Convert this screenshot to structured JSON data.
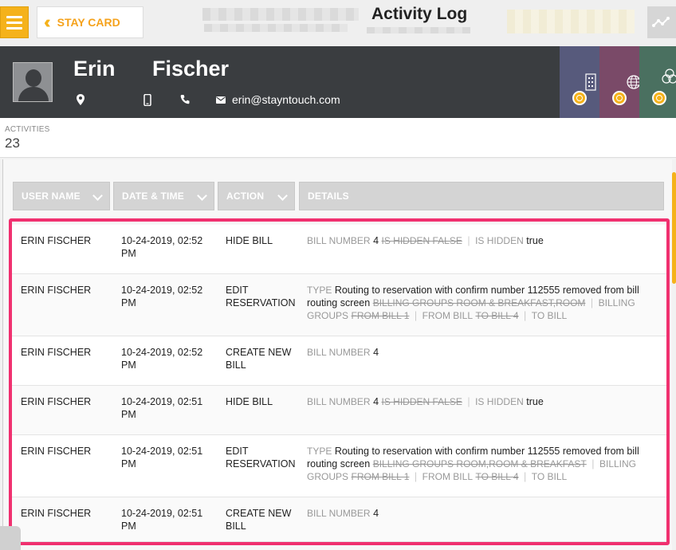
{
  "header": {
    "title": "Activity Log",
    "back_label": "STAY CARD"
  },
  "guest": {
    "first_name": "Erin",
    "last_name": "Fischer",
    "email": "erin@stayntouch.com",
    "tiles": [
      {
        "icon": "building-icon",
        "color": "#575a7c"
      },
      {
        "icon": "globe-icon",
        "color": "#7a4a68"
      },
      {
        "icon": "circles-icon",
        "color": "#4a7060"
      }
    ]
  },
  "activities": {
    "label": "ACTIVITIES",
    "count": "23"
  },
  "columns": [
    "USER NAME",
    "DATE & TIME",
    "ACTION",
    "DETAILS"
  ],
  "rows": [
    {
      "user": "ERIN FISCHER",
      "date": "10-24-2019, 02:52 PM",
      "action": "HIDE BILL",
      "details": [
        {
          "t": "k",
          "v": "BILL NUMBER"
        },
        {
          "t": "v",
          "v": "4"
        },
        {
          "t": "s",
          "v": "IS HIDDEN FALSE"
        },
        {
          "t": "sep",
          "v": "|"
        },
        {
          "t": "k",
          "v": "IS HIDDEN"
        },
        {
          "t": "v",
          "v": "true"
        }
      ]
    },
    {
      "user": "ERIN FISCHER",
      "date": "10-24-2019, 02:52 PM",
      "action": "EDIT RESERVATION",
      "details": [
        {
          "t": "k",
          "v": "TYPE"
        },
        {
          "t": "v",
          "v": "Routing to reservation with confirm number 112555 removed from bill routing screen"
        },
        {
          "t": "s",
          "v": "BILLING GROUPS ROOM & BREAKFAST,ROOM"
        },
        {
          "t": "sep",
          "v": "|"
        },
        {
          "t": "k",
          "v": "BILLING GROUPS"
        },
        {
          "t": "s",
          "v": "FROM BILL 1"
        },
        {
          "t": "sep",
          "v": "|"
        },
        {
          "t": "k",
          "v": "FROM BILL"
        },
        {
          "t": "s",
          "v": "TO BILL 4"
        },
        {
          "t": "sep",
          "v": "|"
        },
        {
          "t": "k",
          "v": "TO BILL"
        }
      ]
    },
    {
      "user": "ERIN FISCHER",
      "date": "10-24-2019, 02:52 PM",
      "action": "CREATE NEW BILL",
      "details": [
        {
          "t": "k",
          "v": "BILL NUMBER"
        },
        {
          "t": "v",
          "v": "4"
        }
      ]
    },
    {
      "user": "ERIN FISCHER",
      "date": "10-24-2019, 02:51 PM",
      "action": "HIDE BILL",
      "details": [
        {
          "t": "k",
          "v": "BILL NUMBER"
        },
        {
          "t": "v",
          "v": "4"
        },
        {
          "t": "s",
          "v": "IS HIDDEN FALSE"
        },
        {
          "t": "sep",
          "v": "|"
        },
        {
          "t": "k",
          "v": "IS HIDDEN"
        },
        {
          "t": "v",
          "v": "true"
        }
      ]
    },
    {
      "user": "ERIN FISCHER",
      "date": "10-24-2019, 02:51 PM",
      "action": "EDIT RESERVATION",
      "details": [
        {
          "t": "k",
          "v": "TYPE"
        },
        {
          "t": "v",
          "v": "Routing to reservation with confirm number 112555 removed from bill routing screen"
        },
        {
          "t": "s",
          "v": "BILLING GROUPS ROOM,ROOM & BREAKFAST"
        },
        {
          "t": "sep",
          "v": "|"
        },
        {
          "t": "k",
          "v": "BILLING GROUPS"
        },
        {
          "t": "s",
          "v": "FROM BILL 1"
        },
        {
          "t": "sep",
          "v": "|"
        },
        {
          "t": "k",
          "v": "FROM BILL"
        },
        {
          "t": "s",
          "v": "TO BILL 4"
        },
        {
          "t": "sep",
          "v": "|"
        },
        {
          "t": "k",
          "v": "TO BILL"
        }
      ]
    },
    {
      "user": "ERIN FISCHER",
      "date": "10-24-2019, 02:51 PM",
      "action": "CREATE NEW BILL",
      "details": [
        {
          "t": "k",
          "v": "BILL NUMBER"
        },
        {
          "t": "v",
          "v": "4"
        }
      ]
    }
  ]
}
